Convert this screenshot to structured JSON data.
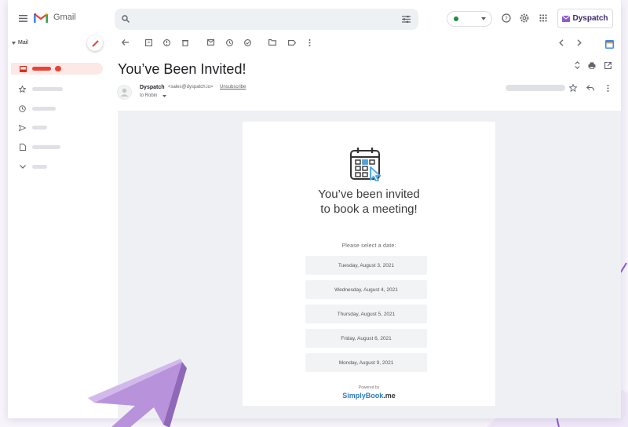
{
  "app": {
    "name": "Gmail",
    "brand_button": "Dyspatch"
  },
  "sidebar": {
    "section_label": "Mail"
  },
  "message": {
    "subject": "You’ve Been Invited!",
    "sender_name": "Dyspatch",
    "sender_email": "<sales@dyspatch.io>",
    "unsubscribe_label": "Unsubscribe",
    "to_line": "to Robin"
  },
  "email_body": {
    "headline_line1": "You’ve been invited",
    "headline_line2": "to book a meeting!",
    "select_label": "Please select a date:",
    "dates": [
      "Tuesday, August 3, 2021",
      "Wednesday, August 4, 2021",
      "Thursday, August 5, 2021",
      "Friday, August 6, 2021",
      "Monday, August 9, 2021"
    ],
    "powered_by": "Powered by",
    "logo_part1": "SimplyBook",
    "logo_part2": ".me"
  },
  "colors": {
    "gmail_red": "#ea4335",
    "status_green": "#1e8e3e",
    "accent_purple": "#8e5bd0",
    "highlight_blue": "#4aa3df"
  },
  "icons": [
    "menu-icon",
    "gmail-logo-icon",
    "search-icon",
    "filter-icon",
    "status-dot-icon",
    "help-icon",
    "settings-icon",
    "apps-icon",
    "compose-icon",
    "inbox-icon",
    "star-icon",
    "clock-icon",
    "send-icon",
    "draft-icon",
    "chevron-down-icon",
    "back-icon",
    "archive-icon",
    "spam-icon",
    "delete-icon",
    "mark-unread-icon",
    "snooze-icon",
    "add-task-icon",
    "move-to-icon",
    "label-icon",
    "more-icon",
    "prev-icon",
    "next-icon",
    "calendar-addon-icon",
    "expand-icon",
    "print-icon",
    "open-new-window-icon",
    "reply-icon",
    "calendar-pointer-icon"
  ]
}
